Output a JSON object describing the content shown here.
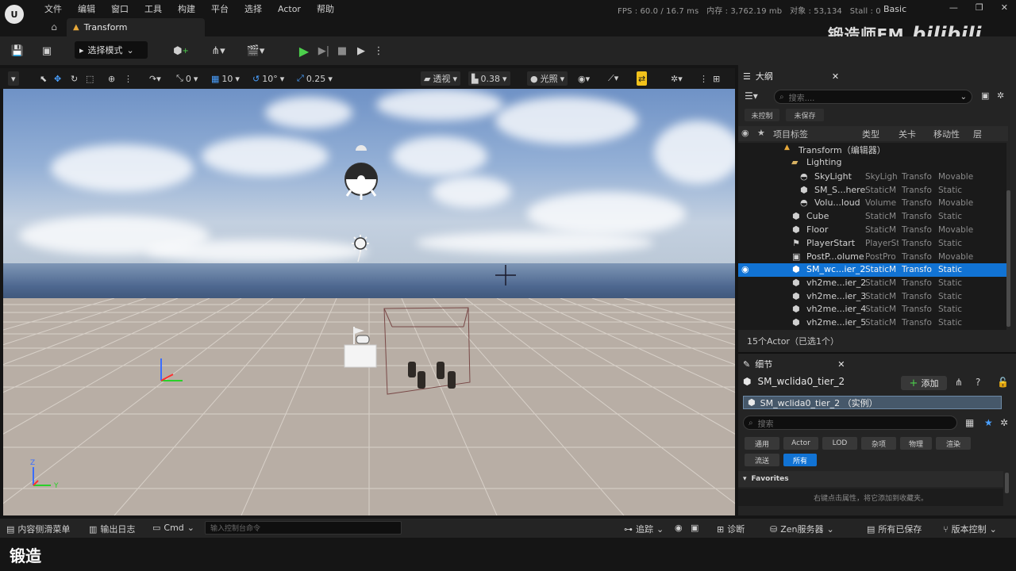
{
  "menu": [
    "文件",
    "编辑",
    "窗口",
    "工具",
    "构建",
    "平台",
    "选择",
    "Actor",
    "帮助"
  ],
  "stats": {
    "fps": "FPS : 60.0",
    "frame": "/ 16.7 ms",
    "memory": "内存 : 3,762.19 mb",
    "objects": "对象 : 53,134",
    "stall": "Stall : 0"
  },
  "preset": "Basic",
  "tab": {
    "title": "Transform"
  },
  "watermark": {
    "text": "锻造师FM",
    "brand": "bilibili"
  },
  "toolbar": {
    "mode": "选择模式"
  },
  "viewport_toolbar": {
    "rotate_snap": "0",
    "move_snap": "10",
    "angle_snap": "10°",
    "scale_snap": "0.25",
    "view_mode": "透视",
    "cam_speed": "0.38",
    "lit_mode": "光照"
  },
  "outliner": {
    "title": "大纲",
    "search_placeholder": "搜索....",
    "chips": [
      "未控制",
      "未保存"
    ],
    "columns": {
      "label": "项目标签",
      "type": "类型",
      "level": "关卡",
      "mobility": "移动性",
      "layer": "层"
    },
    "root": "Transform（编辑器）",
    "folder": "Lighting",
    "rows": [
      {
        "label": "SkyLight",
        "type": "SkyLigh",
        "level": "Transfo",
        "mobility": "Movable"
      },
      {
        "label": "SM_S...here",
        "type": "StaticM",
        "level": "Transfo",
        "mobility": "Static"
      },
      {
        "label": "Volu...loud",
        "type": "Volume",
        "level": "Transfo",
        "mobility": "Movable"
      },
      {
        "label": "Cube",
        "type": "StaticM",
        "level": "Transfo",
        "mobility": "Static"
      },
      {
        "label": "Floor",
        "type": "StaticM",
        "level": "Transfo",
        "mobility": "Movable"
      },
      {
        "label": "PlayerStart",
        "type": "PlayerSt",
        "level": "Transfo",
        "mobility": "Static"
      },
      {
        "label": "PostP...olume",
        "type": "PostPro",
        "level": "Transfo",
        "mobility": "Movable"
      },
      {
        "label": "SM_wc...ier_2",
        "type": "StaticM",
        "level": "Transfo",
        "mobility": "Static"
      },
      {
        "label": "vh2me...ier_2",
        "type": "StaticM",
        "level": "Transfo",
        "mobility": "Static"
      },
      {
        "label": "vh2me...ier_3",
        "type": "StaticM",
        "level": "Transfo",
        "mobility": "Static"
      },
      {
        "label": "vh2me...ier_4",
        "type": "StaticM",
        "level": "Transfo",
        "mobility": "Static"
      },
      {
        "label": "vh2me...ier_5",
        "type": "StaticM",
        "level": "Transfo",
        "mobility": "Static"
      }
    ],
    "status": "15个Actor（已选1个）"
  },
  "details": {
    "title": "细节",
    "actor_name": "SM_wclida0_tier_2",
    "add_label": "添加",
    "instance": "SM_wclida0_tier_2 （实例）",
    "search_placeholder": "搜索",
    "filters": [
      "通用",
      "Actor",
      "LOD",
      "杂项",
      "物理",
      "渲染",
      "流送",
      "所有"
    ],
    "favorites": "Favorites",
    "favorites_hint": "右键点击属性，将它添加到收藏夹。"
  },
  "statusbar": {
    "content_drawer": "内容侧滑菜单",
    "output_log": "输出日志",
    "cmd": "Cmd",
    "cmd_placeholder": "输入控制台命令",
    "trace": "追踪",
    "diagnostics": "诊断",
    "zen": "Zen服务器",
    "save_all": "所有已保存",
    "source_control": "版本控制"
  },
  "subtitle": "锻造",
  "colors": {
    "accent": "#1173d4",
    "play": "#4ccf4c"
  }
}
